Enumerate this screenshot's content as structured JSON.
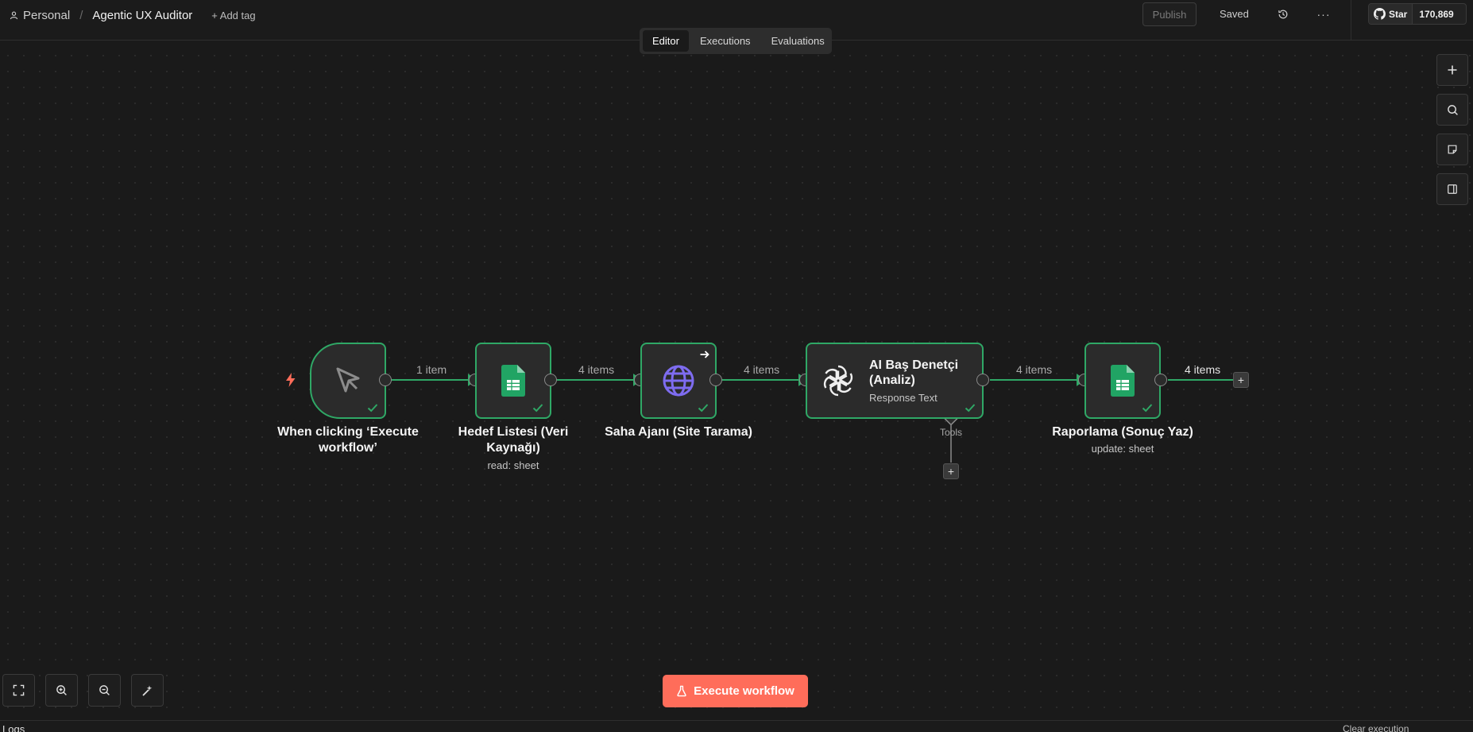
{
  "header": {
    "project": "Personal",
    "separator": "/",
    "workflow_name": "Agentic UX Auditor",
    "add_tag": "+ Add tag",
    "publish_label": "Publish",
    "status": "Saved",
    "more_label": "···",
    "github_star_label": "Star",
    "github_star_count": "170,869"
  },
  "tabs": [
    {
      "label": "Editor",
      "active": true
    },
    {
      "label": "Executions",
      "active": false
    },
    {
      "label": "Evaluations",
      "active": false
    }
  ],
  "right_toolbar": {
    "icons": [
      "plus-icon",
      "search-icon",
      "sticky-note-icon",
      "panel-toggle-icon"
    ]
  },
  "nodes": [
    {
      "id": "trigger",
      "label": "When clicking ‘Execute workflow’",
      "icon": "cursor-icon",
      "status": "success"
    },
    {
      "id": "hedef",
      "label": "Hedef Listesi (Veri Kaynağı)",
      "subtitle": "read: sheet",
      "icon": "google-sheets-icon",
      "status": "success"
    },
    {
      "id": "saha",
      "label": "Saha Ajanı (Site Tarama)",
      "icon": "globe-icon",
      "status": "success"
    },
    {
      "id": "ai",
      "label": "AI Baş Denetçi (Analiz)",
      "subtitle": "Response Text",
      "tools_label": "Tools",
      "icon": "openai-icon",
      "status": "success"
    },
    {
      "id": "rapor",
      "label": "Raporlama (Sonuç Yaz)",
      "subtitle": "update: sheet",
      "icon": "google-sheets-icon",
      "status": "success"
    }
  ],
  "edges": [
    {
      "from": "trigger",
      "to": "hedef",
      "label": "1 item"
    },
    {
      "from": "hedef",
      "to": "saha",
      "label": "4 items"
    },
    {
      "from": "saha",
      "to": "ai",
      "label": "4 items"
    },
    {
      "from": "ai",
      "to": "rapor",
      "label": "4 items"
    },
    {
      "from": "rapor",
      "to": "end",
      "label": "4 items"
    }
  ],
  "bottom": {
    "execute_label": "Execute workflow",
    "logs_label": "Logs",
    "clear_execution": "Clear execution"
  },
  "colors": {
    "accent": "#ff6d5a",
    "success": "#2fa866",
    "background": "#1a1a1a"
  }
}
